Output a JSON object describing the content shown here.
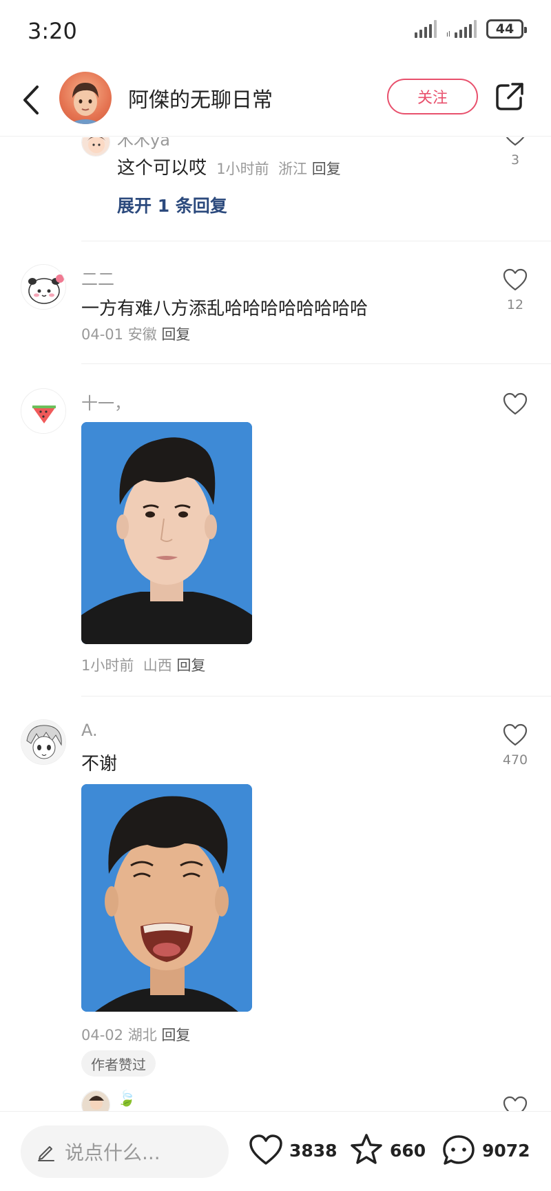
{
  "status_bar": {
    "time": "3:20",
    "battery": "44"
  },
  "header": {
    "title": "阿傑的无聊日常",
    "follow_label": "关注"
  },
  "comments": [
    {
      "name": "木木ya",
      "text": "这个可以哎",
      "time": "1小时前",
      "location": "浙江",
      "reply": "回复",
      "likes": "3",
      "expand": "展开 1 条回复"
    },
    {
      "name": "二二",
      "text": "一方有难八方添乱哈哈哈哈哈哈哈哈",
      "time": "04-01",
      "location": "安徽",
      "reply": "回复",
      "likes": "12"
    },
    {
      "name": "十一，",
      "text": "",
      "time": "1小时前",
      "location": "山西",
      "reply": "回复",
      "likes": ""
    },
    {
      "name": "A.",
      "text": "不谢",
      "time": "04-02",
      "location": "湖北",
      "reply": "回复",
      "likes": "470",
      "badge": "作者赞过"
    },
    {
      "name": "🍃",
      "text": "",
      "likes": ""
    }
  ],
  "bottom": {
    "placeholder": "说点什么...",
    "likes": "3838",
    "favorites": "660",
    "comments": "9072"
  },
  "colors": {
    "accent": "#e8506c",
    "link": "#2c4a7d",
    "photo_bg": "#3e8ad6"
  },
  "icons": [
    "back-icon",
    "share-icon",
    "heart-icon",
    "star-icon",
    "chat-bubble-icon",
    "pencil-icon"
  ]
}
